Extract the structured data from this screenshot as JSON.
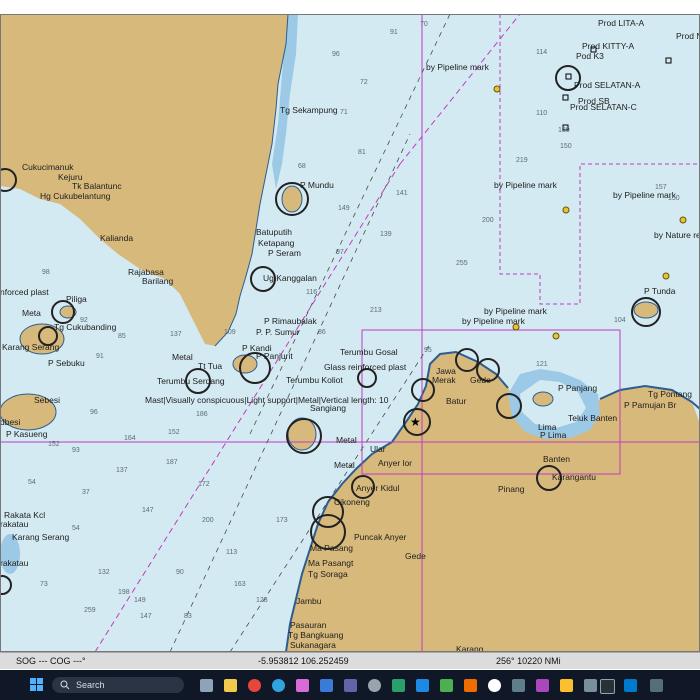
{
  "map": {
    "places": [
      "Prod LITA-A",
      "Prod N",
      "Prod KITTY-A",
      "Pod K3",
      "Prod SELATAN-A",
      "Prod SB",
      "Prod SELATAN-C",
      "by Pipeline mark",
      "by Pipeline mark",
      "by Pipeline mark",
      "by Nature re",
      "by Pipeline mark",
      "by Pipeline mark",
      "Tg Sekampung",
      "Cukucimanuk",
      "Kejuru",
      "Tk Balantunc",
      "Hg Cukubelantung",
      "P Mundu",
      "Kalianda",
      "Batuputih",
      "Ketapang",
      "P Seram",
      "Ug Kanggalan",
      "Rajabasa",
      "Barilang",
      "nforced plast",
      "Piliga",
      "Meta",
      "Tg Cukubanding",
      "Karang Serang",
      "P Sebuku",
      "P Rimaubalak",
      "P. P. Sumur",
      "P Kandi",
      "P Panjurit",
      "Metal",
      "Tt Tua",
      "Terumbu Serdang",
      "Terumbu Gosal",
      "Glass reinforced plast",
      "Terumbu Koliot",
      "Jawa",
      "Merak",
      "Gede",
      "P Tunda",
      "P Panjang",
      "Tg Pontang",
      "P Pamujan Br",
      "Teluk Banten",
      "Batur",
      "Sebesi",
      "dbesi",
      "P Kasueng",
      "Mast|Visually conspicuous|Light support|Metal|Vertical length: 10",
      "Sangiang",
      "Metal",
      "Ular",
      "Metal",
      "Anyer lor",
      "Lima",
      "P Lima",
      "Banten",
      "Karangantu",
      "Anyer Kidul",
      "Cikoneng",
      "Pinang",
      "Rakata Kcl",
      "rakatau",
      "Karang Serang",
      "Puncak Anyer",
      "Gede",
      "Ma Pasang",
      "Ma Pasangt",
      "Tg Soraga",
      "rakatau",
      "Jambu",
      "Pasauran",
      "Tg Bangkuang",
      "Sukanagara",
      "Karang"
    ],
    "depths": [
      "70",
      "91",
      "96",
      "114",
      "110",
      "130",
      "150",
      "157",
      "150",
      "104",
      "219",
      "200",
      "255",
      "213",
      "95",
      "121",
      "141",
      "149",
      "139",
      "137",
      "109",
      "92",
      "98",
      "85",
      "91",
      "96",
      "164",
      "152",
      "186",
      "187",
      "147",
      "200",
      "172",
      "173",
      "137",
      "152",
      "54",
      "37",
      "93",
      "54",
      "132",
      "90",
      "73",
      "113",
      "163",
      "149",
      "128",
      "198",
      "259",
      "147",
      "83",
      "68",
      "71",
      "72",
      "81",
      "97",
      "116",
      "86"
    ],
    "colors": {
      "sea": "#d4eaf2",
      "land": "#d8b97c",
      "shallow": "#9cc9e6",
      "route": "#c13bc1",
      "coast": "#2c5d8f"
    }
  },
  "statusbar": {
    "sog_cog": "SOG --- COG ---°",
    "position": "-5.953812  106.252459",
    "bearing_range": "256°  10220 NMi"
  },
  "taskbar": {
    "search": "Search",
    "icons": [
      "windows-logo",
      "search-icon",
      "widgets-icon",
      "file-explorer-icon",
      "chrome-icon",
      "edge-icon",
      "photos-icon",
      "store-icon",
      "teams-icon",
      "settings-icon",
      "chart-app-icon",
      "vscode-icon",
      "terminal-icon"
    ]
  }
}
